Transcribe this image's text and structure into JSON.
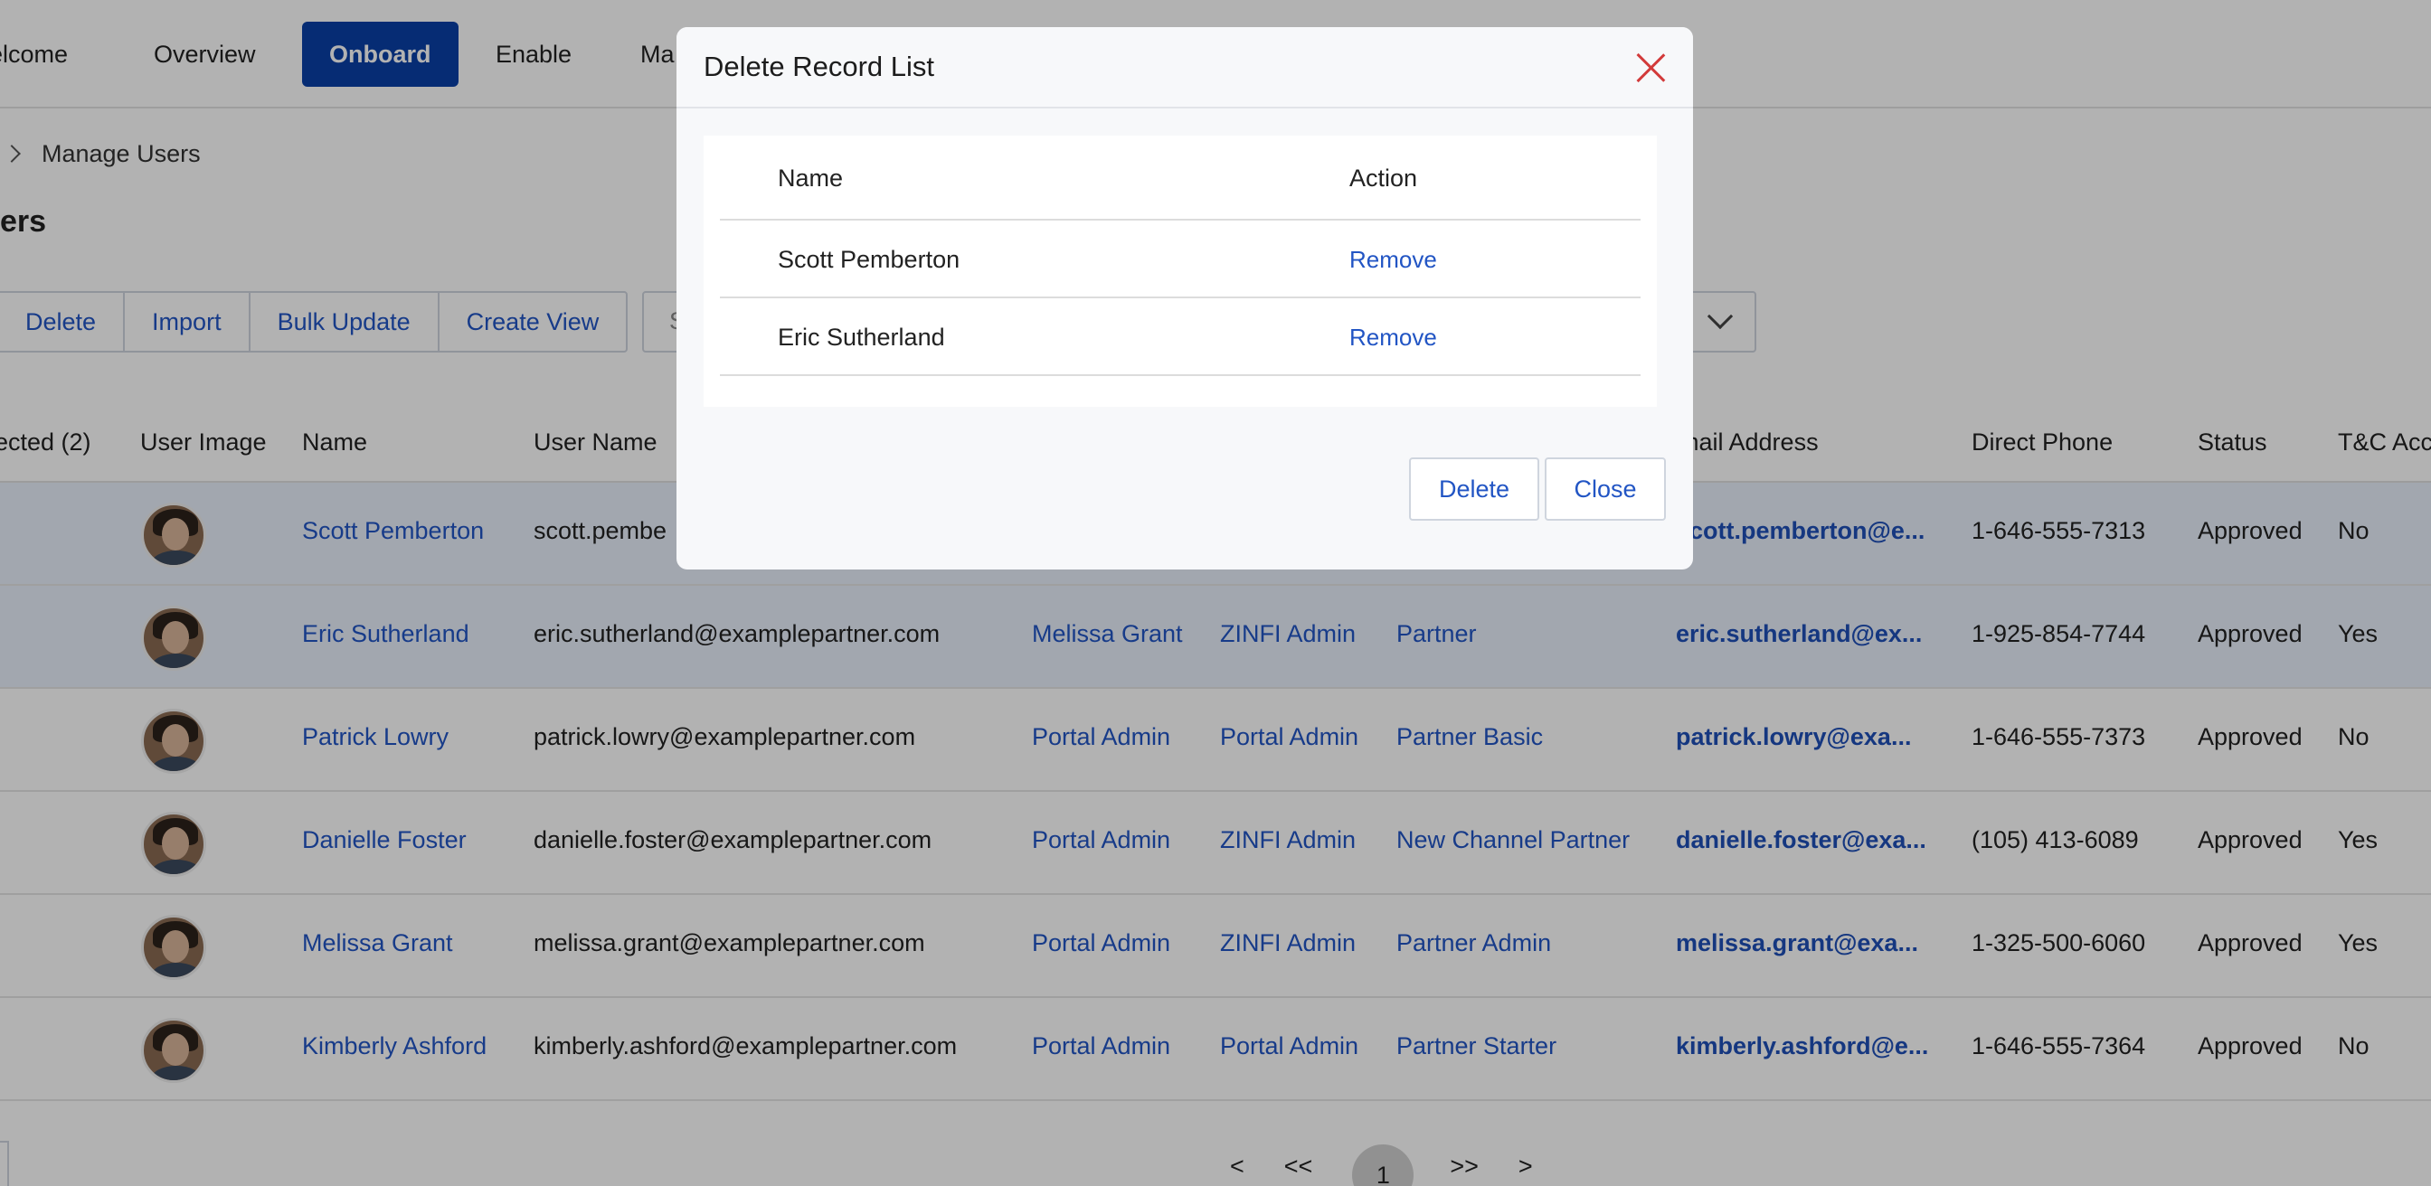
{
  "nav": {
    "items": [
      "elcome",
      "Overview",
      "Onboard",
      "Enable",
      "Ma"
    ],
    "active": "Onboard"
  },
  "breadcrumb": {
    "current": "Manage Users"
  },
  "page": {
    "title": "ers"
  },
  "toolbar": {
    "buttons": [
      "Delete",
      "Import",
      "Bulk Update",
      "Create View"
    ],
    "search_partial": "S"
  },
  "table": {
    "headers": [
      "ected (2)",
      "User Image",
      "Name",
      "User Name",
      "mail Address",
      "Direct Phone",
      "Status",
      "T&C Acc"
    ],
    "rows": [
      {
        "name": "Scott Pemberton",
        "username": "scott.pembe",
        "c1": "",
        "c2": "",
        "c3": "",
        "email": "scott.pemberton@e...",
        "phone": "1-646-555-7313",
        "status": "Approved",
        "tc": "No",
        "selected": true
      },
      {
        "name": "Eric Sutherland",
        "username": "eric.sutherland@examplepartner.com",
        "c1": "Melissa Grant",
        "c2": "ZINFI Admin",
        "c3": "Partner",
        "email": "eric.sutherland@ex...",
        "phone": "1-925-854-7744",
        "status": "Approved",
        "tc": "Yes",
        "selected": true
      },
      {
        "name": "Patrick Lowry",
        "username": "patrick.lowry@examplepartner.com",
        "c1": "Portal Admin",
        "c2": "Portal Admin",
        "c3": "Partner Basic",
        "email": "patrick.lowry@exa...",
        "phone": "1-646-555-7373",
        "status": "Approved",
        "tc": "No",
        "selected": false
      },
      {
        "name": "Danielle Foster",
        "username": "danielle.foster@examplepartner.com",
        "c1": "Portal Admin",
        "c2": "ZINFI Admin",
        "c3": "New Channel Partner",
        "email": "danielle.foster@exa...",
        "phone": "(105) 413-6089",
        "status": "Approved",
        "tc": "Yes",
        "selected": false
      },
      {
        "name": "Melissa Grant",
        "username": "melissa.grant@examplepartner.com",
        "c1": "Portal Admin",
        "c2": "ZINFI Admin",
        "c3": "Partner Admin",
        "email": "melissa.grant@exa...",
        "phone": "1-325-500-6060",
        "status": "Approved",
        "tc": "Yes",
        "selected": false
      },
      {
        "name": "Kimberly Ashford",
        "username": "kimberly.ashford@examplepartner.com",
        "c1": "Portal Admin",
        "c2": "Portal Admin",
        "c3": "Partner Starter",
        "email": "kimberly.ashford@e...",
        "phone": "1-646-555-7364",
        "status": "Approved",
        "tc": "No",
        "selected": false
      }
    ]
  },
  "pagination": {
    "prev": "<",
    "first": "<<",
    "current": "1",
    "last": ">>",
    "next": ">"
  },
  "modal": {
    "title": "Delete Record List",
    "headers": {
      "name": "Name",
      "action": "Action"
    },
    "rows": [
      {
        "name": "Scott Pemberton",
        "action": "Remove"
      },
      {
        "name": "Eric Sutherland",
        "action": "Remove"
      }
    ],
    "delete_label": "Delete",
    "close_label": "Close"
  },
  "colors": {
    "brand": "#0a3fa6",
    "link": "#2255c4",
    "close_icon": "#d23a3a",
    "selected_row": "#e8f0fb"
  }
}
